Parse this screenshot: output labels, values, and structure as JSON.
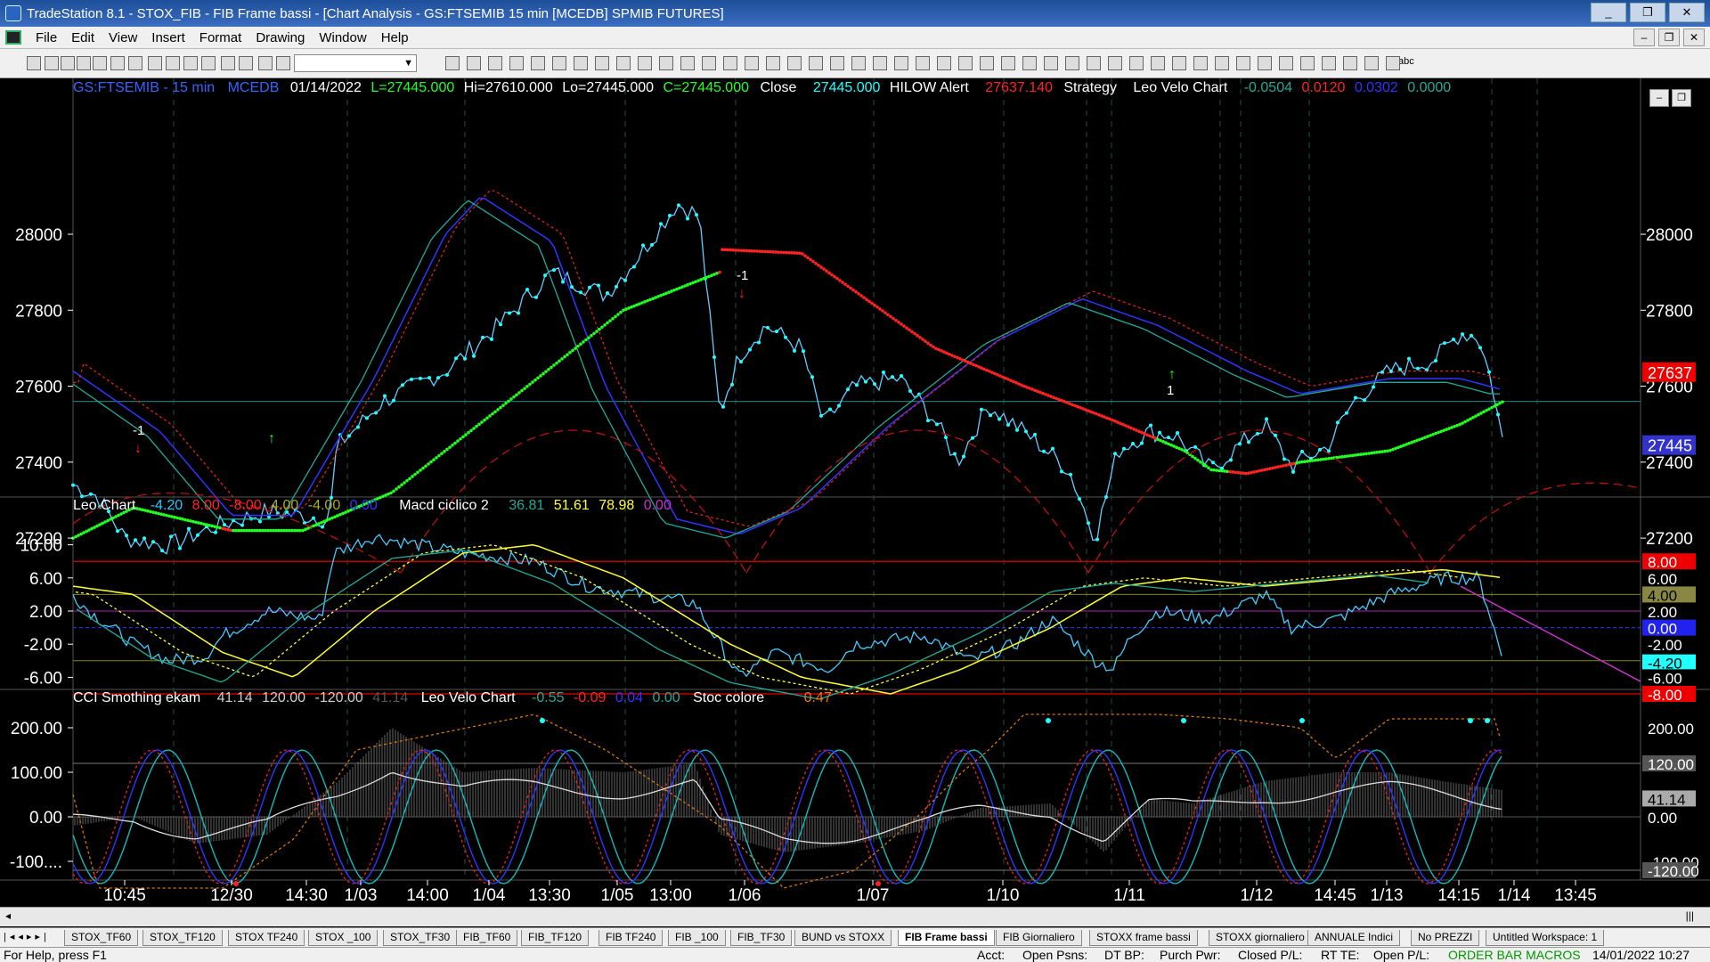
{
  "window": {
    "title": "TradeStation 8.1 - STOX_FIB - FIB Frame bassi - [Chart Analysis - GS:FTSEMIB  15 min  [MCEDB] SPMIB FUTURES]",
    "buttons": [
      "_",
      "❐",
      "✕"
    ]
  },
  "menu": [
    "File",
    "Edit",
    "View",
    "Insert",
    "Format",
    "Drawing",
    "Window",
    "Help"
  ],
  "mdi_buttons": [
    "–",
    "❐",
    "✕"
  ],
  "chart_mdi_buttons": [
    "–",
    "❐"
  ],
  "toolbar": {
    "symbol_value": "",
    "abc_label": "abc"
  },
  "header": {
    "symbol": "GS:FTSEMIB - 15 min",
    "source": "MCEDB",
    "date": "01/14/2022",
    "low_label": "L=27445.000",
    "hi_label": "Hi=27610.000",
    "lo_label": "Lo=27445.000",
    "close_label": "C=27445.000",
    "close_word": "Close",
    "close_value": "27445.000",
    "hilow_label": "HILOW Alert",
    "hilow_value": "27637.140",
    "strategy_label": "Strategy",
    "leo_velo_label": "Leo Velo Chart",
    "leo_velo_values": [
      "-0.0504",
      "0.0120",
      "0.0302",
      "0.0000"
    ]
  },
  "panel2_header": {
    "leo_chart_label": "Leo Chart",
    "leo_values": [
      "-4.20",
      "8.00",
      "-8.00",
      "4.00",
      "-4.00",
      "0.00"
    ],
    "macd_label": "Macd ciclico 2",
    "macd_values": [
      "36.81",
      "51.61",
      "78.98",
      "0.00"
    ]
  },
  "panel3_header": {
    "cci_label": "CCI Smothing ekam",
    "cci_values": [
      "41.14",
      "120.00",
      "-120.00",
      "41.14"
    ],
    "leo_velo_label": "Leo Velo Chart",
    "leo_velo_values": [
      "-0.55",
      "-0.09",
      "0.04",
      "0.00"
    ],
    "stoc_label": "Stoc colore",
    "stoc_value": "0.47"
  },
  "axes": {
    "price_ticks": [
      "28000",
      "27800",
      "27600",
      "27400",
      "27200"
    ],
    "price_markers": {
      "hilow": "27637",
      "last": "27445"
    },
    "osc_ticks": [
      "10.00",
      "6.00",
      "2.00",
      "-2.00",
      "-6.00"
    ],
    "osc_markers": [
      "8.00",
      "6.00",
      "4.00",
      "2.00",
      "0.00",
      "-2.00",
      "-4.20",
      "-6.00",
      "-8.00"
    ],
    "cci_ticks": [
      "200.00",
      "100.00",
      "0.00",
      "-100...."
    ],
    "cci_right_ticks": [
      "200.00",
      "120.00",
      "41.14",
      "0.00",
      "-100.00",
      "-120.00"
    ],
    "time_labels": [
      "10:45",
      "12/30",
      "14:30",
      "1/03",
      "14:00",
      "1/04",
      "13:30",
      "1/05",
      "13:00",
      "1/06",
      "1/07",
      "1/10",
      "1/11",
      "1/12",
      "14:45",
      "1/13",
      "14:15",
      "1/14",
      "13:45"
    ]
  },
  "signals": {
    "short": "-1",
    "long": "1"
  },
  "tabs": [
    "STOX_TF60",
    "STOX_TF120",
    "STOX TF240",
    "STOX _100",
    "STOX_TF30",
    "FIB_TF60",
    "FIB_TF120",
    "FIB TF240",
    "FIB _100",
    "FIB_TF30",
    "BUND vs STOXX",
    "FIB Frame bassi",
    "FIB Giornaliero",
    "STOXX frame bassi",
    "STOXX giornaliero",
    "ANNUALE Indici",
    "No PREZZI",
    "Untitled Workspace:  1"
  ],
  "active_tab": "FIB Frame bassi",
  "status": {
    "help": "For Help, press F1",
    "acct": "Acct:",
    "open_psns": "Open Psns:",
    "dt_bp": "DT BP:",
    "purch_pwr": "Purch Pwr:",
    "closed_pl": "Closed P/L:",
    "rt_te": "RT TE:",
    "open_pl": "Open P/L:",
    "macros": "ORDER BAR  MACROS",
    "datetime": "14/01/2022 10:27"
  },
  "colors": {
    "price_line": "#6cf",
    "ma_green": "#2f2",
    "ma_red": "#f22",
    "blue": "#33f",
    "teal": "#2a9",
    "yellow": "#ff3",
    "magenta": "#c3c"
  }
}
